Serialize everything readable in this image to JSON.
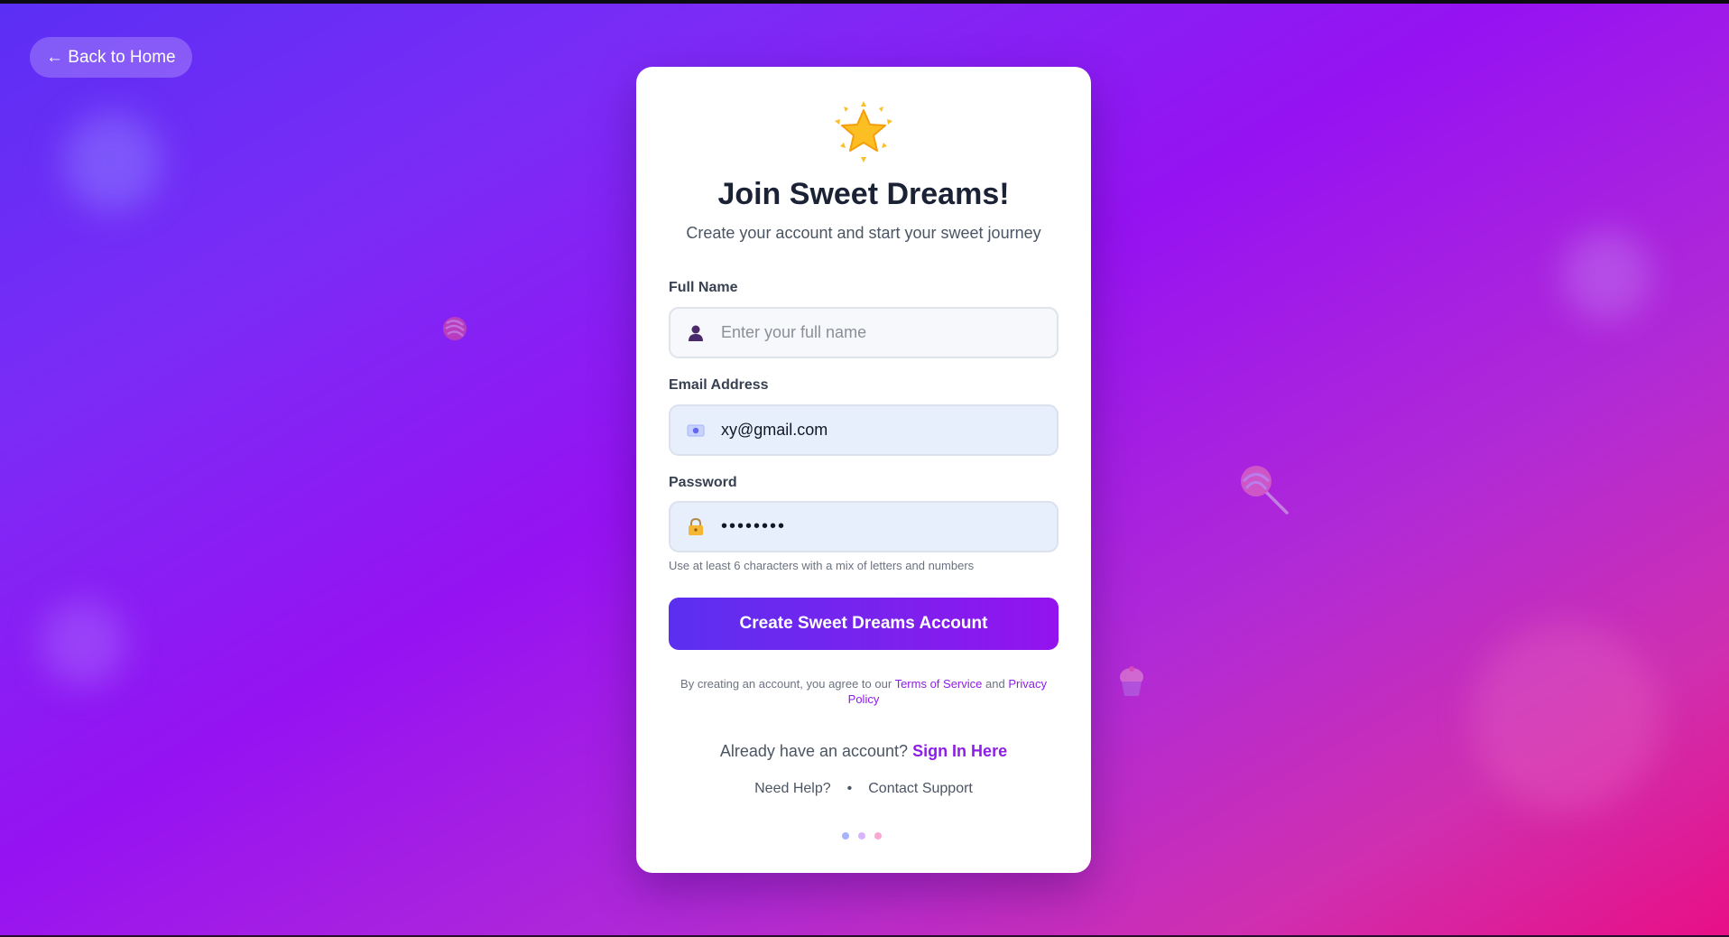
{
  "nav": {
    "back_label": "← Back to Home"
  },
  "form": {
    "icon": "star-icon",
    "title": "Join Sweet Dreams!",
    "subtitle": "Create your account and start your sweet journey",
    "full_name": {
      "label": "Full Name",
      "placeholder": "Enter your full name",
      "value": "",
      "icon": "user-icon"
    },
    "email": {
      "label": "Email Address",
      "value": "xy@gmail.com",
      "icon": "email-icon"
    },
    "password": {
      "label": "Password",
      "value": "••••••••",
      "icon": "lock-icon",
      "hint": "Use at least 6 characters with a mix of letters and numbers"
    },
    "submit_label": "Create Sweet Dreams Account",
    "terms": {
      "prefix": "By creating an account, you agree to our",
      "tos": "Terms of Service",
      "and": "and",
      "privacy": "Privacy Policy"
    },
    "signin": {
      "prompt": "Already have an account?",
      "link": "Sign In Here"
    },
    "help": {
      "need_help": "Need Help?",
      "separator": "•",
      "contact": "Contact Support"
    }
  },
  "decorations": [
    "candy-icon",
    "lollipop-icon",
    "cupcake-icon"
  ],
  "colors": {
    "accent": "#8e1de6",
    "button_start": "#5b2ff0",
    "button_end": "#9412ee",
    "dot_1": "#a5b4fc",
    "dot_2": "#d8b4fe",
    "dot_3": "#f9a8d4"
  }
}
